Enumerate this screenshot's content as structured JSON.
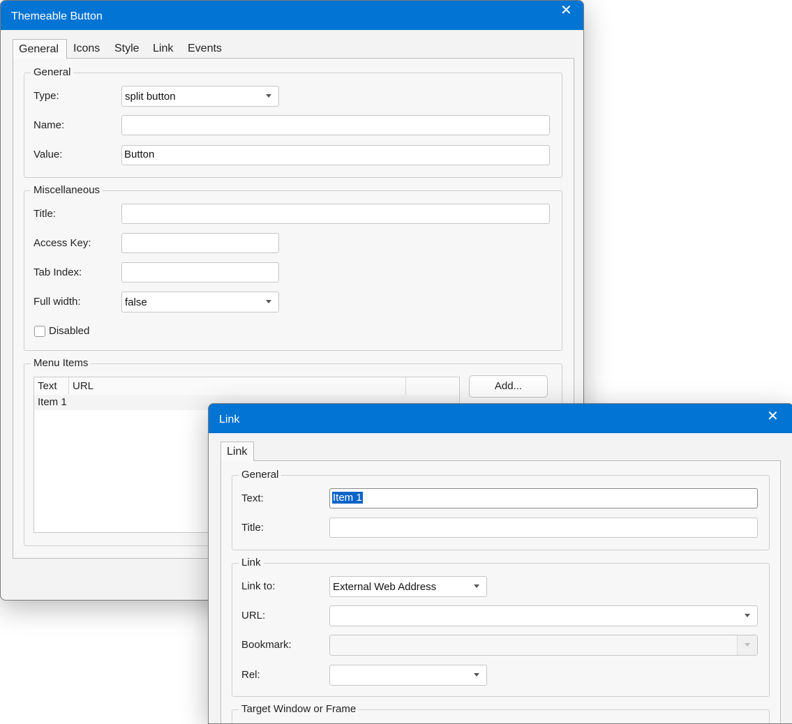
{
  "dialog1": {
    "title": "Themeable Button",
    "close_glyph": "✕",
    "tabs": [
      "General",
      "Icons",
      "Style",
      "Link",
      "Events"
    ],
    "general": {
      "legend": "General",
      "type_label": "Type:",
      "type_value": "split button",
      "name_label": "Name:",
      "name_value": "",
      "value_label": "Value:",
      "value_value": "Button"
    },
    "misc": {
      "legend": "Miscellaneous",
      "title_label": "Title:",
      "title_value": "",
      "accesskey_label": "Access Key:",
      "accesskey_value": "",
      "tabindex_label": "Tab Index:",
      "tabindex_value": "",
      "fullwidth_label": "Full width:",
      "fullwidth_value": "false",
      "disabled_label": "Disabled",
      "disabled_checked": false
    },
    "menu": {
      "legend": "Menu Items",
      "columns": [
        "Text",
        "URL"
      ],
      "rows": [
        [
          "Item 1",
          ""
        ]
      ],
      "add_label": "Add..."
    }
  },
  "dialog2": {
    "title": "Link",
    "close_glyph": "✕",
    "tabs": [
      "Link"
    ],
    "general": {
      "legend": "General",
      "text_label": "Text:",
      "text_value": "Item 1",
      "title_label": "Title:",
      "title_value": ""
    },
    "link": {
      "legend": "Link",
      "linkto_label": "Link to:",
      "linkto_value": "External Web Address",
      "url_label": "URL:",
      "url_value": "",
      "bookmark_label": "Bookmark:",
      "bookmark_value": "",
      "rel_label": "Rel:",
      "rel_value": ""
    },
    "target": {
      "legend": "Target Window or Frame"
    }
  },
  "colors": {
    "titlebar": "#0274d3",
    "selection": "#0a64c8"
  },
  "icons": {
    "close": "close-icon",
    "dropdown": "chevron-down-icon"
  }
}
